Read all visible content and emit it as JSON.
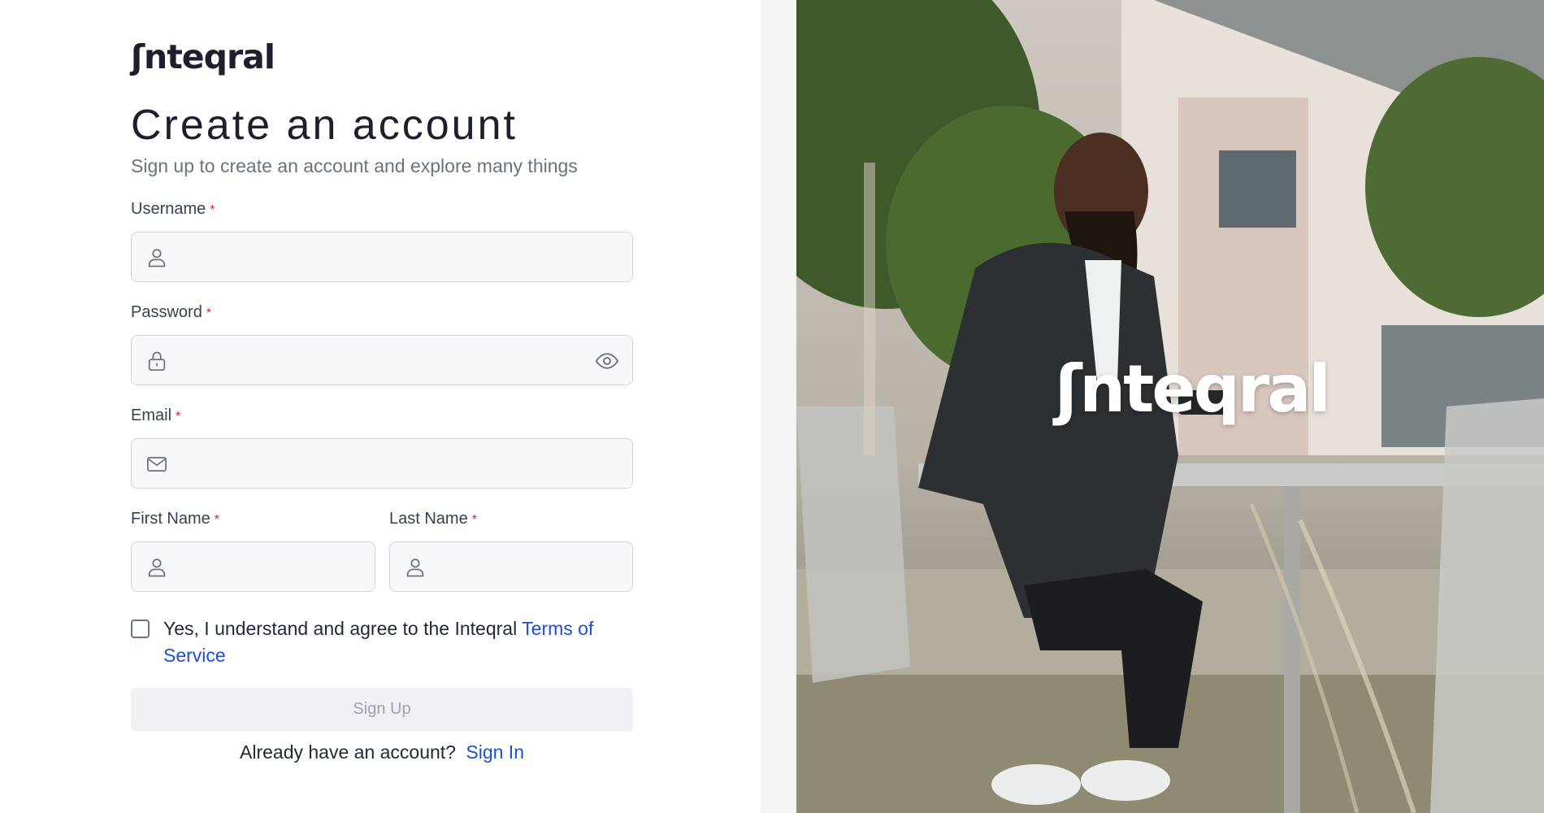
{
  "brand": {
    "name": "ʃnteqral"
  },
  "header": {
    "title": "Create an account",
    "subtitle": "Sign up to create an account and explore many things"
  },
  "form": {
    "required_marker": "*",
    "username": {
      "label": "Username",
      "value": "",
      "placeholder": "",
      "icon": "user-icon"
    },
    "password": {
      "label": "Password",
      "value": "",
      "placeholder": "",
      "icon": "lock-icon",
      "toggle_icon": "eye-icon"
    },
    "email": {
      "label": "Email",
      "value": "",
      "placeholder": "",
      "icon": "mail-icon"
    },
    "first_name": {
      "label": "First Name",
      "value": "",
      "placeholder": "",
      "icon": "user-icon"
    },
    "last_name": {
      "label": "Last Name",
      "value": "",
      "placeholder": "",
      "icon": "user-icon"
    },
    "terms": {
      "checked": false,
      "text": "Yes, I understand and agree to the Inteqral ",
      "link_label": "Terms of Service"
    },
    "submit_label": "Sign Up",
    "signin": {
      "prompt": "Already have an account?",
      "link_label": "Sign In"
    }
  },
  "hero": {
    "overlay_logo": "ʃnteqral"
  },
  "colors": {
    "accent": "#1d4ed8",
    "required": "#dc2626",
    "text_dark": "#1d1f2e",
    "text_muted": "#6b7280",
    "button_disabled_bg": "#f0f1f4"
  }
}
